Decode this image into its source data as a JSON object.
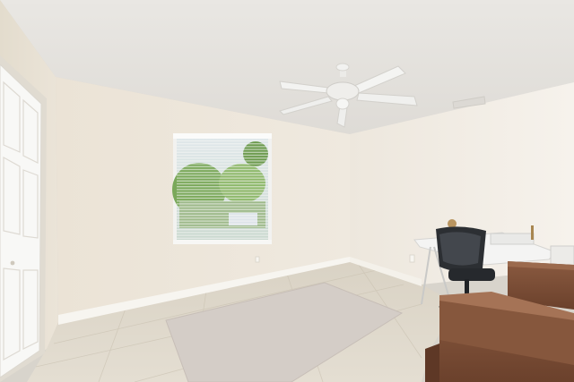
{
  "scene": {
    "kind": "photograph",
    "colors": {
      "ceiling": "#e6e4e0",
      "left_wall": "#ece6da",
      "back_wall": "#efe8dd",
      "right_wall": "#f1ece4",
      "floor_tile": "#ddd6c8",
      "rug": "#d5cdc8",
      "baseboard": "#f7f5f0",
      "door": "#f8f8f6",
      "window_blind": "#f4f4f2",
      "foliage": "#7aa85a",
      "fan": "#f2f2f0",
      "desk_wood": "#7a4d35",
      "chair": "#2c2f33"
    }
  }
}
